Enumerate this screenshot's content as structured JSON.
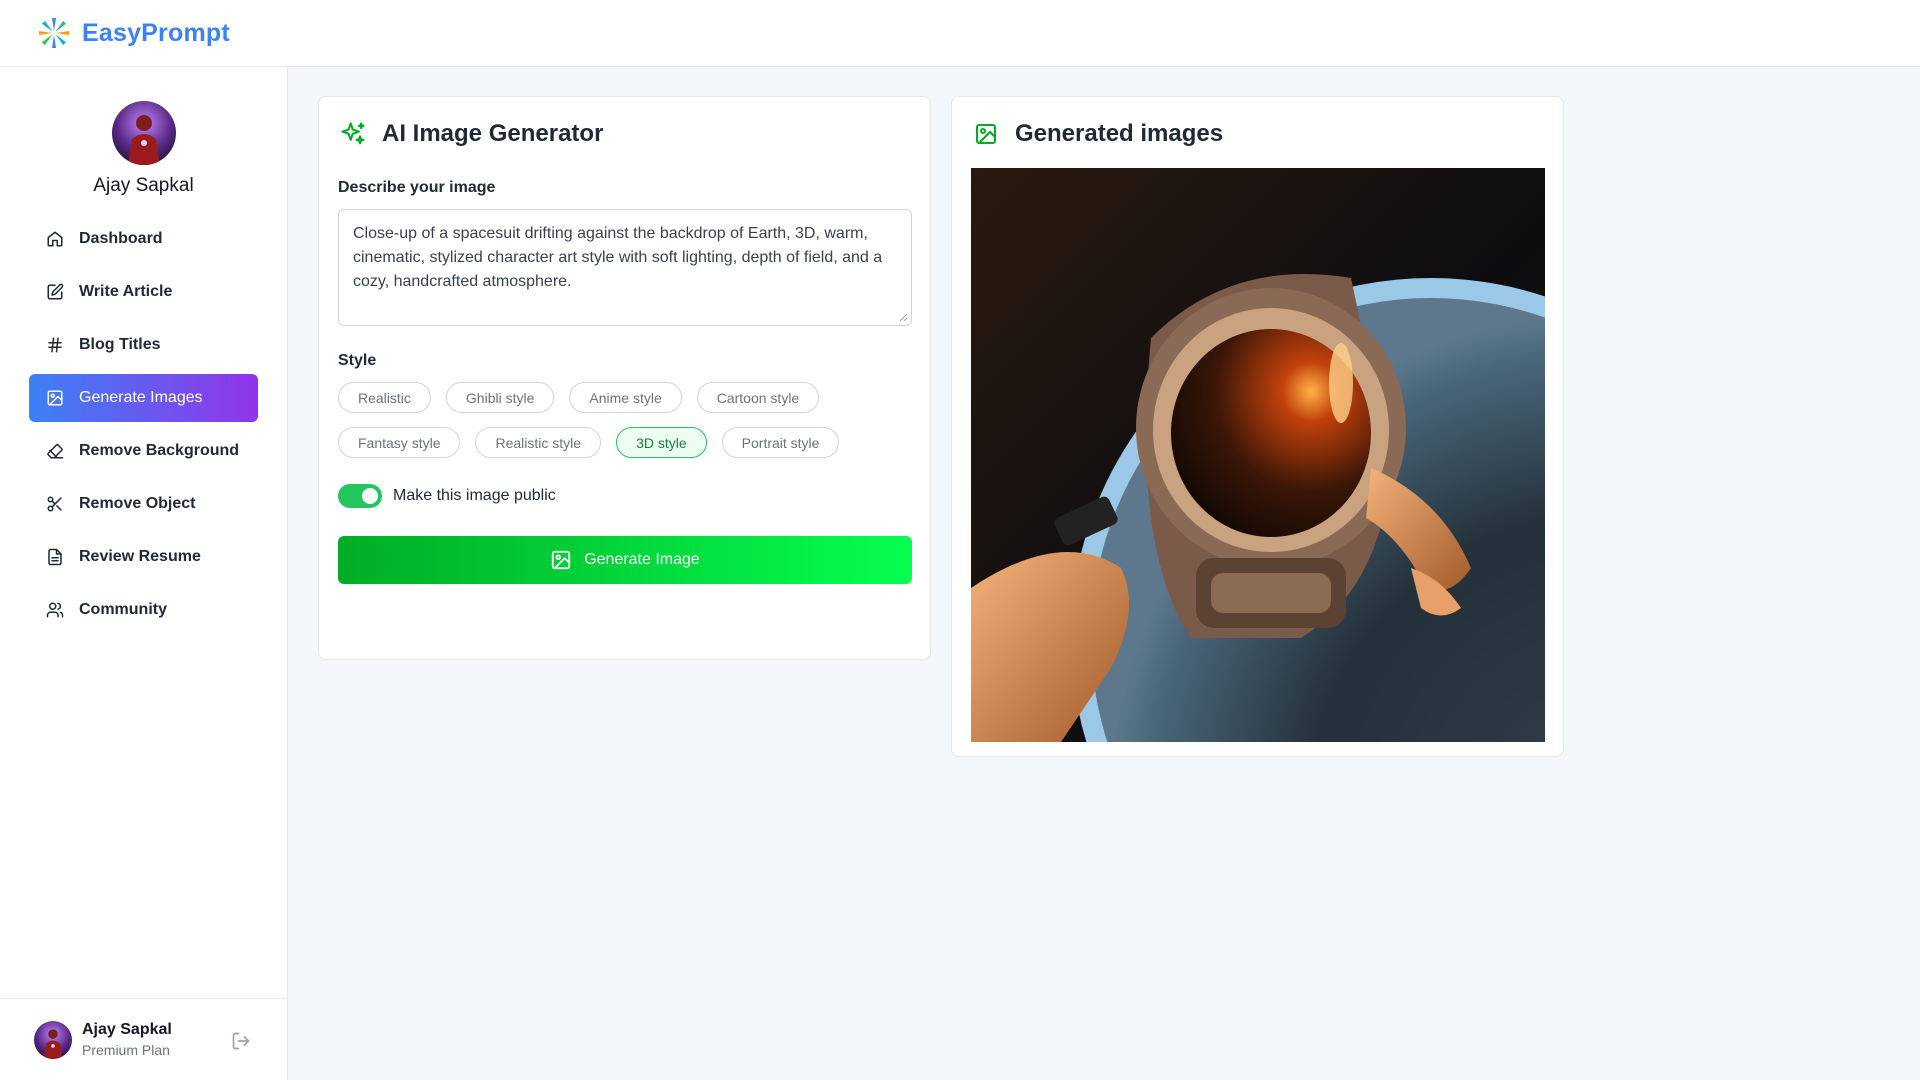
{
  "app": {
    "name": "EasyPrompt"
  },
  "user": {
    "name": "Ajay Sapkal",
    "plan": "Premium Plan"
  },
  "sidebar": {
    "items": [
      {
        "label": "Dashboard",
        "icon": "home-icon",
        "active": false
      },
      {
        "label": "Write Article",
        "icon": "edit-icon",
        "active": false
      },
      {
        "label": "Blog Titles",
        "icon": "hash-icon",
        "active": false
      },
      {
        "label": "Generate Images",
        "icon": "image-icon",
        "active": true
      },
      {
        "label": "Remove Background",
        "icon": "eraser-icon",
        "active": false
      },
      {
        "label": "Remove Object",
        "icon": "scissors-icon",
        "active": false
      },
      {
        "label": "Review Resume",
        "icon": "file-text-icon",
        "active": false
      },
      {
        "label": "Community",
        "icon": "users-icon",
        "active": false
      }
    ]
  },
  "generator": {
    "title": "AI Image Generator",
    "describe_label": "Describe your image",
    "prompt_value": "Close-up of a spacesuit drifting against the backdrop of Earth, 3D, warm, cinematic, stylized character art style with soft lighting, depth of field, and a cozy, handcrafted atmosphere.",
    "style_label": "Style",
    "styles": [
      {
        "label": "Realistic",
        "selected": false
      },
      {
        "label": "Ghibli style",
        "selected": false
      },
      {
        "label": "Anime style",
        "selected": false
      },
      {
        "label": "Cartoon style",
        "selected": false
      },
      {
        "label": "Fantasy style",
        "selected": false
      },
      {
        "label": "Realistic style",
        "selected": false
      },
      {
        "label": "3D style",
        "selected": true
      },
      {
        "label": "Portrait style",
        "selected": false
      }
    ],
    "public_toggle_label": "Make this image public",
    "public_toggle_on": true,
    "button_label": "Generate Image"
  },
  "results": {
    "title": "Generated images"
  },
  "colors": {
    "brand_blue": "#3b82f6",
    "active_gradient_start": "#3c81f6",
    "active_gradient_end": "#9234ea",
    "green": "#22c55e",
    "button_gradient_start": "#00ad25",
    "button_gradient_end": "#04ff50"
  }
}
